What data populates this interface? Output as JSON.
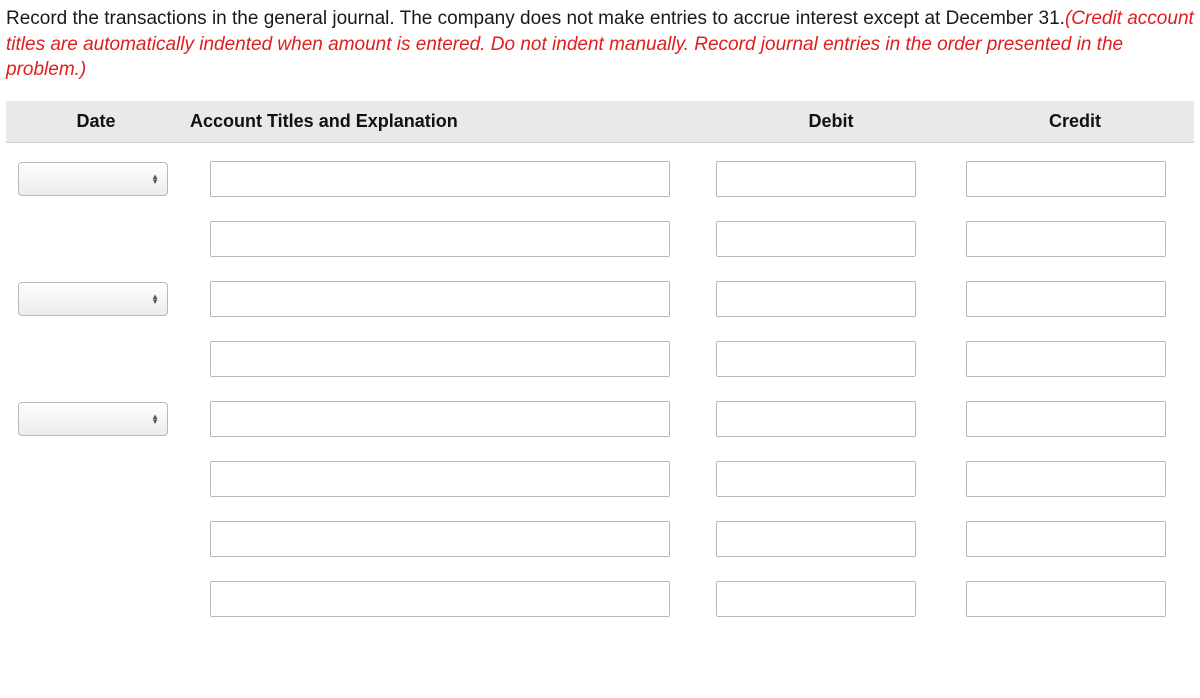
{
  "instructions": {
    "black": "Record the transactions in the general journal. The company does not make entries to accrue interest except at December 31.",
    "red": "(Credit account titles are automatically indented when amount is entered. Do not indent manually. Record journal entries in the order presented in the problem.)"
  },
  "columns": {
    "date": "Date",
    "account": "Account Titles and Explanation",
    "debit": "Debit",
    "credit": "Credit"
  },
  "rows": [
    {
      "date_selector": true,
      "account": "",
      "debit": "",
      "credit": ""
    },
    {
      "date_selector": false,
      "account": "",
      "debit": "",
      "credit": ""
    },
    {
      "date_selector": true,
      "account": "",
      "debit": "",
      "credit": ""
    },
    {
      "date_selector": false,
      "account": "",
      "debit": "",
      "credit": ""
    },
    {
      "date_selector": true,
      "account": "",
      "debit": "",
      "credit": ""
    },
    {
      "date_selector": false,
      "account": "",
      "debit": "",
      "credit": ""
    },
    {
      "date_selector": false,
      "account": "",
      "debit": "",
      "credit": ""
    },
    {
      "date_selector": false,
      "account": "",
      "debit": "",
      "credit": ""
    }
  ]
}
